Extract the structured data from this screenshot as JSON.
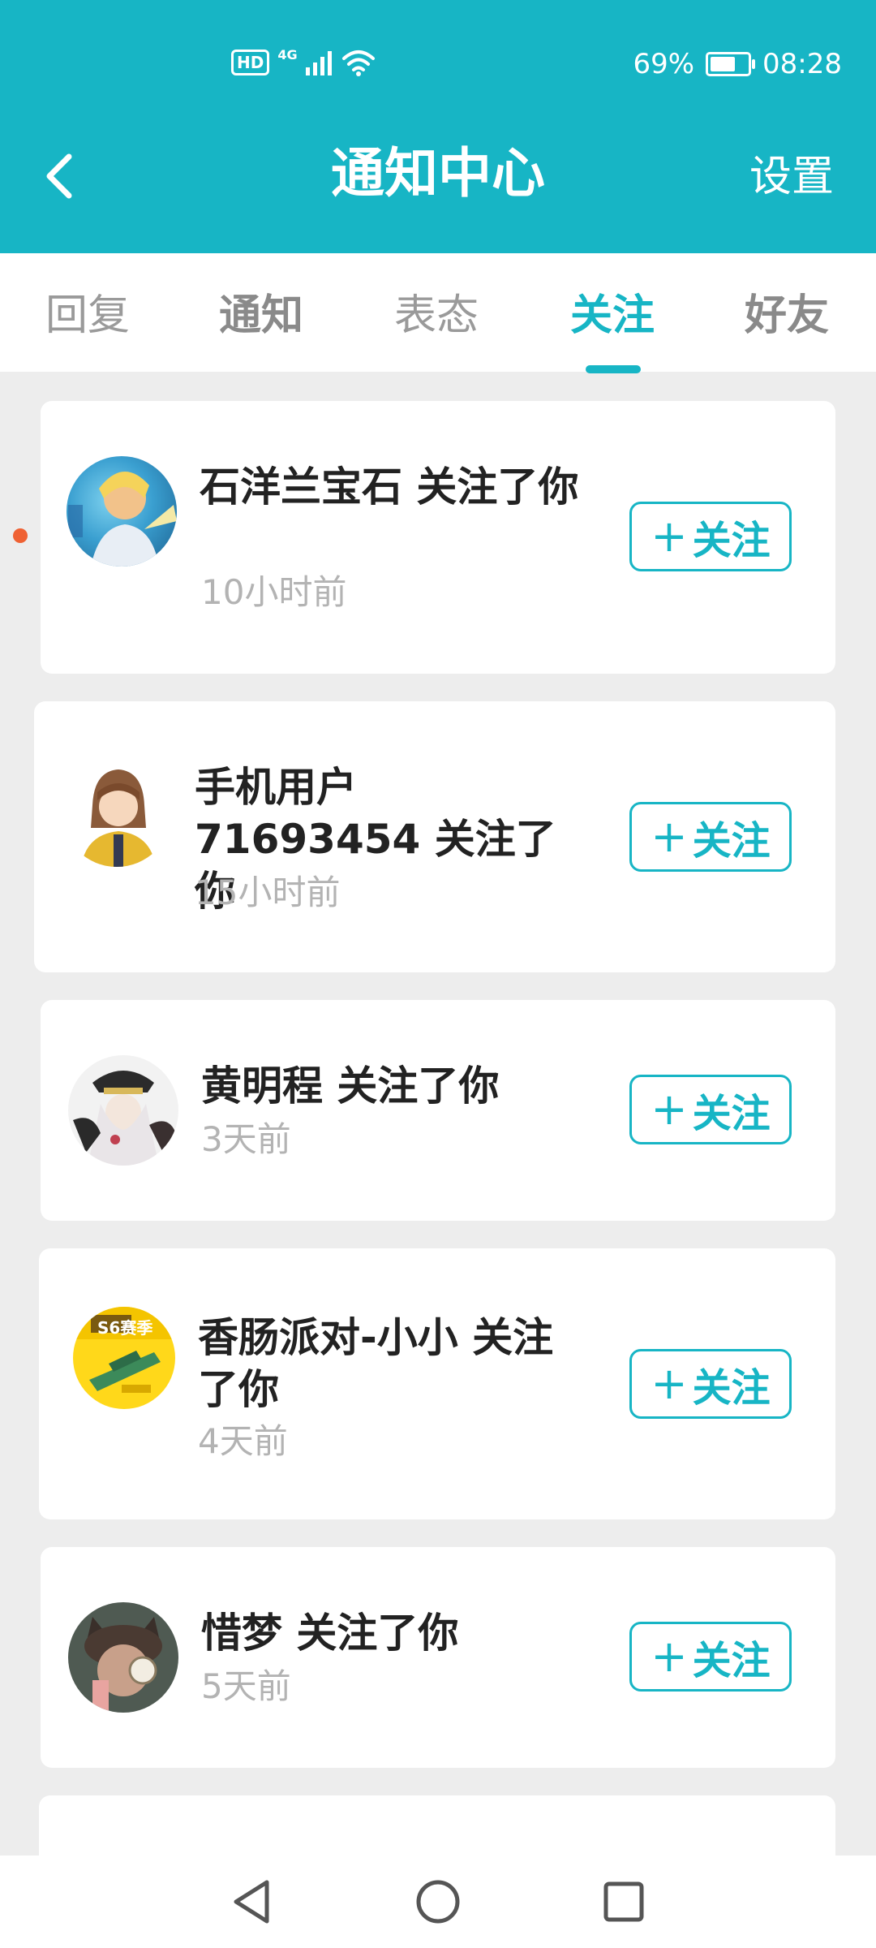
{
  "status_bar": {
    "hd": "HD",
    "network": "4G",
    "battery": "69%",
    "battery_level": 0.69,
    "time": "08:28"
  },
  "header": {
    "title": "通知中心",
    "settings": "设置"
  },
  "tabs": [
    {
      "label": "回复"
    },
    {
      "label": "通知"
    },
    {
      "label": "表态"
    },
    {
      "label": "关注",
      "active": true
    },
    {
      "label": "好友"
    }
  ],
  "notifications": [
    {
      "text": "石洋兰宝石 关注了你",
      "time": "10小时前",
      "button": "关注",
      "unread": true
    },
    {
      "text": "手机用户71693454 关注了你",
      "time": "15小时前",
      "button": "关注"
    },
    {
      "text": "黄明程 关注了你",
      "time": "3天前",
      "button": "关注"
    },
    {
      "text": "香肠派对-小小 关注了你",
      "time": "4天前",
      "button": "关注",
      "avatar_text": "S6赛季"
    },
    {
      "text": "惜梦 关注了你",
      "time": "5天前",
      "button": "关注"
    }
  ],
  "colors": {
    "accent": "#17b5c5",
    "unread_dot": "#ef6133",
    "background": "#ededed"
  }
}
